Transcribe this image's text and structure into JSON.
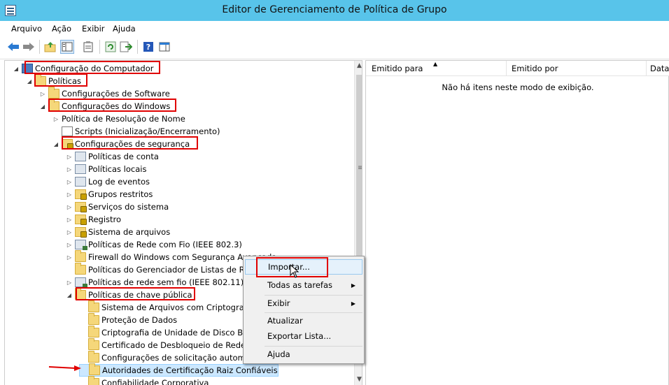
{
  "window": {
    "title": "Editor de Gerenciamento de Política de Grupo"
  },
  "menu": [
    "Arquivo",
    "Ação",
    "Exibir",
    "Ajuda"
  ],
  "toolbar_icons": [
    "back-icon",
    "forward-icon",
    "up-folder-icon",
    "show-hide-tree-icon",
    "properties-icon",
    "refresh-icon",
    "export-list-icon",
    "help-icon",
    "show-hide-action-pane-icon"
  ],
  "tree": [
    {
      "label": "Configuração do Computador",
      "icon": "computer-icon",
      "expander": "◢"
    },
    {
      "label": "Políticas",
      "icon": "folder-icon",
      "expander": "◢"
    },
    {
      "label": "Configurações de Software",
      "icon": "folder-icon",
      "expander": "▷"
    },
    {
      "label": "Configurações do Windows",
      "icon": "folder-icon",
      "expander": "◢"
    },
    {
      "label": "Política de Resolução de Nome",
      "icon": "",
      "expander": "▷"
    },
    {
      "label": "Scripts (Inicialização/Encerramento)",
      "icon": "script-icon",
      "expander": ""
    },
    {
      "label": "Configurações de segurança",
      "icon": "security-folder-icon",
      "expander": "◢"
    },
    {
      "label": "Políticas de conta",
      "icon": "policy-icon",
      "expander": "▷"
    },
    {
      "label": "Políticas locais",
      "icon": "policy-icon",
      "expander": "▷"
    },
    {
      "label": "Log de eventos",
      "icon": "policy-icon",
      "expander": "▷"
    },
    {
      "label": "Grupos restritos",
      "icon": "security-folder-icon",
      "expander": "▷"
    },
    {
      "label": "Serviços do sistema",
      "icon": "security-folder-icon",
      "expander": "▷"
    },
    {
      "label": "Registro",
      "icon": "security-folder-icon",
      "expander": "▷"
    },
    {
      "label": "Sistema de arquivos",
      "icon": "security-folder-icon",
      "expander": "▷"
    },
    {
      "label": "Políticas de Rede com Fio (IEEE 802.3)",
      "icon": "network-policy-icon",
      "expander": "▷"
    },
    {
      "label": "Firewall do Windows com Segurança Avançada",
      "icon": "folder-icon",
      "expander": "▷"
    },
    {
      "label": "Políticas do Gerenciador de Listas de Rede",
      "icon": "folder-icon",
      "expander": ""
    },
    {
      "label": "Políticas de rede sem fio (IEEE 802.11)",
      "icon": "network-policy-icon",
      "expander": "▷"
    },
    {
      "label": "Políticas de chave pública",
      "icon": "folder-icon",
      "expander": "◢"
    },
    {
      "label": "Sistema de Arquivos com Criptografia",
      "icon": "folder-icon",
      "expander": ""
    },
    {
      "label": "Proteção de Dados",
      "icon": "folder-icon",
      "expander": ""
    },
    {
      "label": "Criptografia de Unidade de Disco BitL",
      "icon": "folder-icon",
      "expander": ""
    },
    {
      "label": "Certificado de Desbloqueio de Rede d",
      "icon": "folder-icon",
      "expander": ""
    },
    {
      "label": "Configurações de solicitação automát",
      "icon": "folder-icon",
      "expander": ""
    },
    {
      "label": "Autoridades de Certificação Raiz Confiáveis",
      "icon": "folder-icon",
      "expander": ""
    },
    {
      "label": "Confiabilidade Corporativa",
      "icon": "folder-icon",
      "expander": ""
    }
  ],
  "columns": [
    "Emitido para",
    "Emitido por",
    "Data"
  ],
  "empty_message": "Não há itens neste modo de exibição.",
  "context_menu": {
    "import": "Importar...",
    "all_tasks": "Todas as tarefas",
    "view": "Exibir",
    "refresh": "Atualizar",
    "export_list": "Exportar Lista...",
    "help": "Ajuda"
  },
  "colors": {
    "titlebar": "#58c4ea",
    "highlight_box": "#e00000",
    "menu_hover": "#e5f1fb"
  }
}
